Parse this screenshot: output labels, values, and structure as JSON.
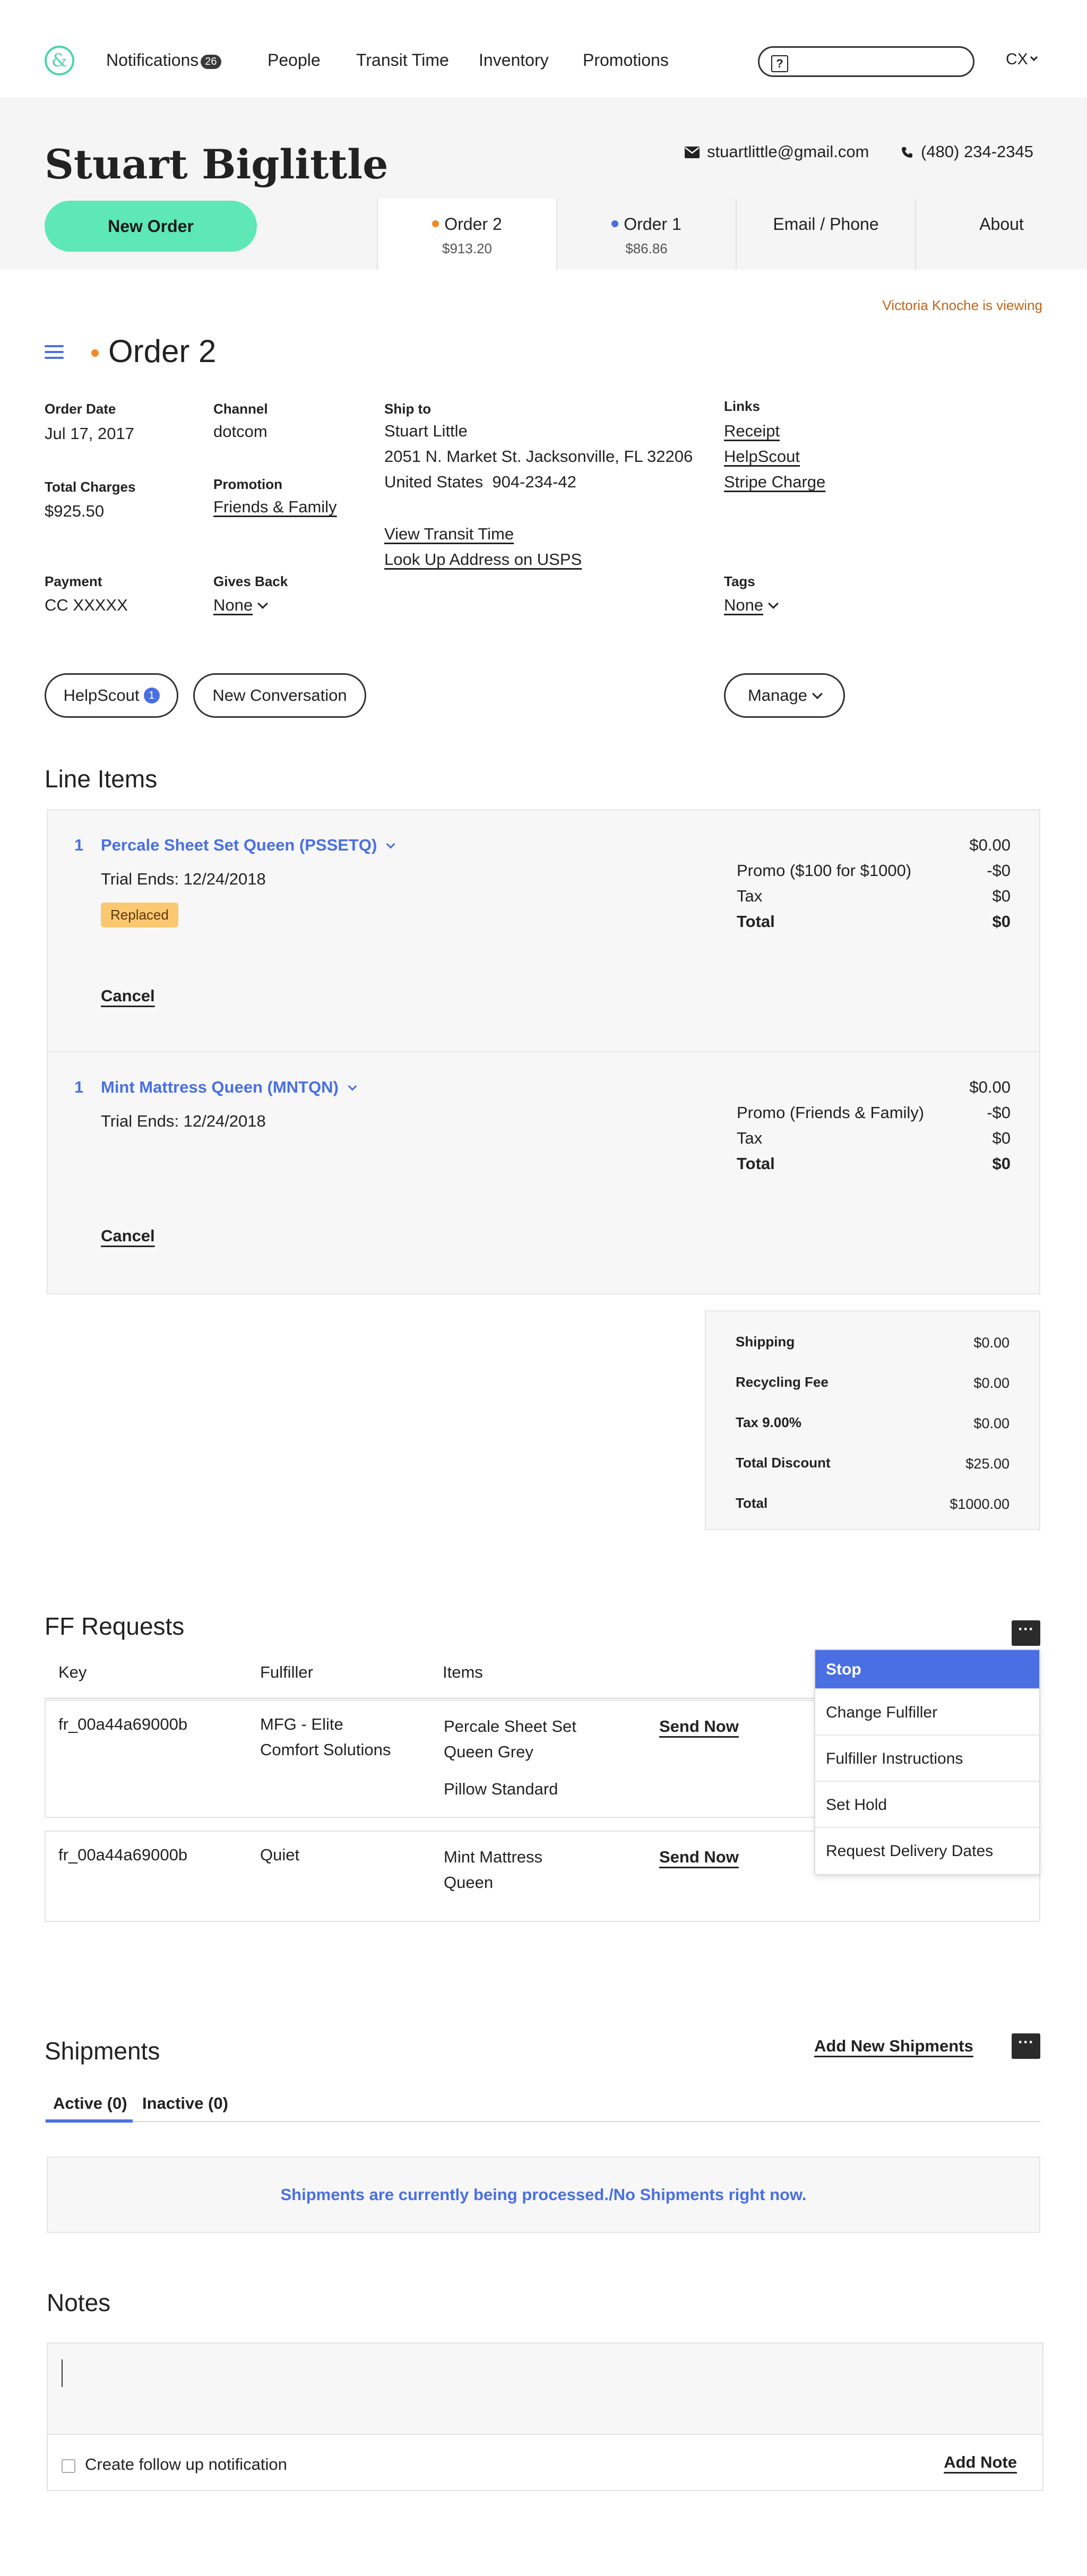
{
  "nav": {
    "logo": "&",
    "notifications_label": "Notifications",
    "notifications_count": "26",
    "people": "People",
    "transit_time": "Transit Time",
    "inventory": "Inventory",
    "promotions": "Promotions",
    "search_icon": "?",
    "search_placeholder": "",
    "user_menu": "CX"
  },
  "customer": {
    "name": "Stuart Biglittle",
    "email": "stuartlittle@gmail.com",
    "phone": "(480) 234-2345"
  },
  "header": {
    "new_order": "New Order",
    "tabs": [
      {
        "label": "Order 2",
        "sub": "$913.20",
        "dot_color": "#f08a24"
      },
      {
        "label": "Order 1",
        "sub": "$86.86",
        "dot_color": "#4a6fe3"
      },
      {
        "label": "Email / Phone",
        "sub": ""
      },
      {
        "label": "About",
        "sub": ""
      }
    ]
  },
  "viewing_notice": "Victoria Knoche is viewing",
  "order": {
    "title": "Order 2",
    "order_date_label": "Order Date",
    "order_date": "Jul 17, 2017",
    "channel_label": "Channel",
    "channel": "dotcom",
    "ship_to_label": "Ship to",
    "ship_to_name": "Stuart Little",
    "ship_to_address": "2051 N. Market St. Jacksonville, FL 32206",
    "ship_to_country_phone": "United States  904-234-42",
    "view_transit_time": "View Transit Time",
    "look_up_usps": "Look Up Address on USPS",
    "links_label": "Links",
    "link_receipt": "Receipt",
    "link_helpscout": "HelpScout",
    "link_stripe": "Stripe Charge",
    "total_charges_label": "Total Charges",
    "total_charges": "$925.50",
    "promotion_label": "Promotion",
    "promotion": "Friends & Family",
    "payment_label": "Payment",
    "payment": "CC XXXXX",
    "gives_back_label": "Gives Back",
    "gives_back": "None",
    "tags_label": "Tags",
    "tags": "None",
    "helpscout_button": "HelpScout",
    "helpscout_count": "1",
    "new_conversation_button": "New Conversation",
    "manage_button": "Manage"
  },
  "line_items": {
    "title": "Line Items",
    "items": [
      {
        "qty": "1",
        "name": "Percale Sheet Set Queen  (PSSETQ)",
        "trial": "Trial Ends: 12/24/2018",
        "badge": "Replaced",
        "cancel": "Cancel",
        "price": "$0.00",
        "promo_label": "Promo ($100 for $1000)",
        "promo_value": "-$0",
        "tax_label": "Tax",
        "tax_value": "$0",
        "total_label": "Total",
        "total_value": "$0"
      },
      {
        "qty": "1",
        "name": "Mint Mattress Queen (MNTQN)",
        "trial": "Trial Ends: 12/24/2018",
        "badge": "",
        "cancel": "Cancel",
        "price": "$0.00",
        "promo_label": "Promo (Friends & Family)",
        "promo_value": "-$0",
        "tax_label": "Tax",
        "tax_value": "$0",
        "total_label": "Total",
        "total_value": "$0"
      }
    ]
  },
  "totals": [
    {
      "label": "Shipping",
      "value": "$0.00"
    },
    {
      "label": "Recycling Fee",
      "value": "$0.00"
    },
    {
      "label": "Tax 9.00%",
      "value": "$0.00"
    },
    {
      "label": "Total Discount",
      "value": "$25.00"
    },
    {
      "label": "Total",
      "value": "$1000.00"
    }
  ],
  "ff_requests": {
    "title": "FF Requests",
    "columns": [
      "Key",
      "Fulfiller",
      "Items"
    ],
    "rows": [
      {
        "key": "fr_00a44a69000b",
        "fulfiller_line1": "MFG - Elite",
        "fulfiller_line2": "Comfort Solutions",
        "item1_line1": "Percale Sheet Set",
        "item1_line2": "Queen Grey",
        "item2": "Pillow Standard",
        "action": "Send Now"
      },
      {
        "key": "fr_00a44a69000b",
        "fulfiller_line1": "Quiet",
        "fulfiller_line2": "",
        "item1_line1": "Mint Mattress",
        "item1_line2": "Queen",
        "item2": "",
        "action": "Send Now"
      }
    ],
    "menu_button": "···",
    "menu_options": [
      "Stop",
      "Change Fulfiller",
      "Fulfiller Instructions",
      "Set Hold",
      "Request Delivery Dates"
    ]
  },
  "shipments": {
    "title": "Shipments",
    "add_new": "Add New Shipments",
    "menu_button": "···",
    "tab_active": "Active (0)",
    "tab_inactive": "Inactive (0)",
    "message": "Shipments are currently being processed./No Shipments right now."
  },
  "notes": {
    "title": "Notes",
    "textarea_value": "",
    "follow_up_label": "Create follow up notification",
    "add_note": "Add Note"
  }
}
